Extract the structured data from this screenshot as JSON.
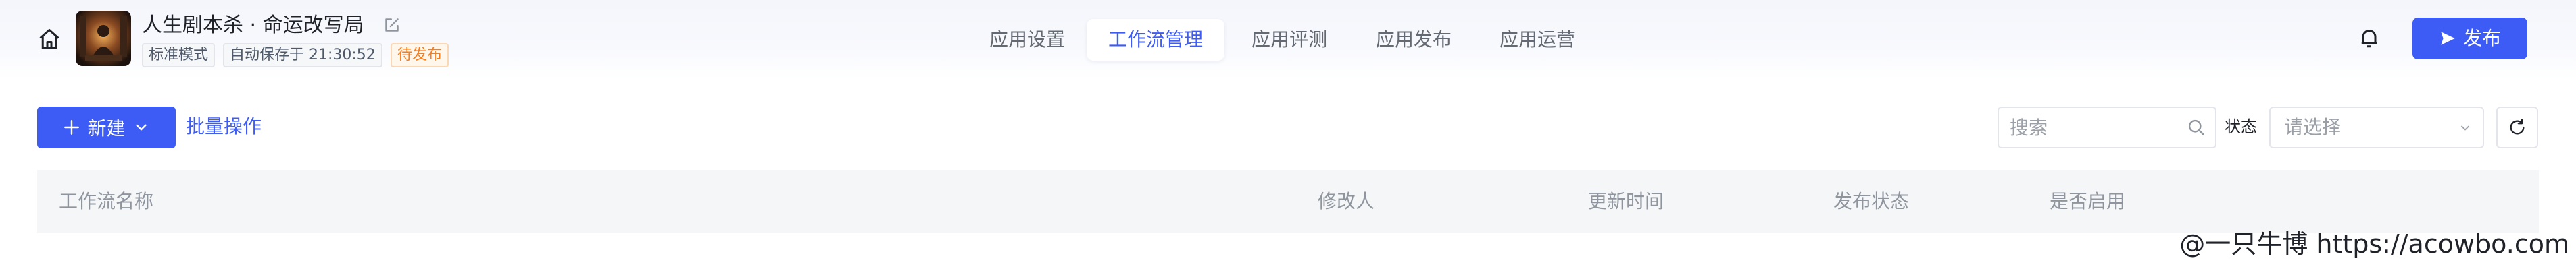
{
  "header": {
    "app_title": "人生剧本杀 · 命运改写局",
    "tags": {
      "mode": "标准模式",
      "autosave": "自动保存于 21:30:52",
      "status": "待发布"
    },
    "nav_tabs": [
      {
        "label": "应用设置",
        "active": false
      },
      {
        "label": "工作流管理",
        "active": true
      },
      {
        "label": "应用评测",
        "active": false
      },
      {
        "label": "应用发布",
        "active": false
      },
      {
        "label": "应用运营",
        "active": false
      }
    ],
    "publish_label": "发布"
  },
  "toolbar": {
    "new_label": "新建",
    "batch_label": "批量操作",
    "search": {
      "placeholder": "搜索",
      "value": ""
    },
    "status_label": "状态",
    "status_select": {
      "placeholder": "请选择"
    }
  },
  "table": {
    "columns": [
      "工作流名称",
      "修改人",
      "更新时间",
      "发布状态",
      "是否启用"
    ]
  },
  "watermark": "@一只牛博 https://acowbo.com",
  "colors": {
    "accent": "#3d5cf5",
    "status_pending": "#f77d1c",
    "header_bg": "#f4f6fc",
    "table_head_bg": "#f5f6f7"
  },
  "icons": [
    "home-icon",
    "edit-icon",
    "bell-icon",
    "send-icon",
    "plus-icon",
    "chevron-down-icon",
    "search-icon",
    "refresh-icon"
  ]
}
